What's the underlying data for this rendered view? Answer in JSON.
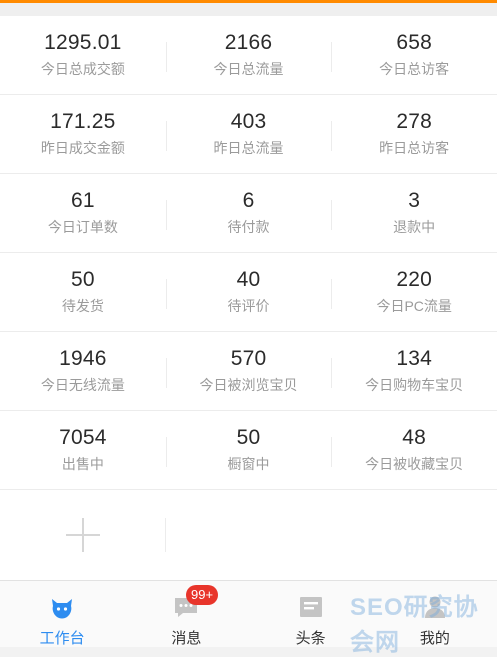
{
  "colors": {
    "accent": "#2d8cf0",
    "badge": "#e8352b",
    "top_bar": "#ff8a00"
  },
  "stats": [
    [
      {
        "value": "1295.01",
        "label": "今日总成交额"
      },
      {
        "value": "2166",
        "label": "今日总流量"
      },
      {
        "value": "658",
        "label": "今日总访客"
      }
    ],
    [
      {
        "value": "171.25",
        "label": "昨日成交金额"
      },
      {
        "value": "403",
        "label": "昨日总流量"
      },
      {
        "value": "278",
        "label": "昨日总访客"
      }
    ],
    [
      {
        "value": "61",
        "label": "今日订单数"
      },
      {
        "value": "6",
        "label": "待付款"
      },
      {
        "value": "3",
        "label": "退款中"
      }
    ],
    [
      {
        "value": "50",
        "label": "待发货"
      },
      {
        "value": "40",
        "label": "待评价"
      },
      {
        "value": "220",
        "label": "今日PC流量"
      }
    ],
    [
      {
        "value": "1946",
        "label": "今日无线流量"
      },
      {
        "value": "570",
        "label": "今日被浏览宝贝"
      },
      {
        "value": "134",
        "label": "今日购物车宝贝"
      }
    ],
    [
      {
        "value": "7054",
        "label": "出售中"
      },
      {
        "value": "50",
        "label": "橱窗中"
      },
      {
        "value": "48",
        "label": "今日被收藏宝贝"
      }
    ]
  ],
  "add_icon": "plus-icon",
  "tabbar": {
    "tabs": [
      {
        "label": "工作台",
        "icon": "workbench-icon",
        "active": true
      },
      {
        "label": "消息",
        "icon": "message-icon",
        "active": false
      },
      {
        "label": "头条",
        "icon": "news-icon",
        "active": false
      },
      {
        "label": "我的",
        "icon": "profile-icon",
        "active": false
      }
    ],
    "message_badge": "99+"
  },
  "watermark": "SEO研究协会网"
}
